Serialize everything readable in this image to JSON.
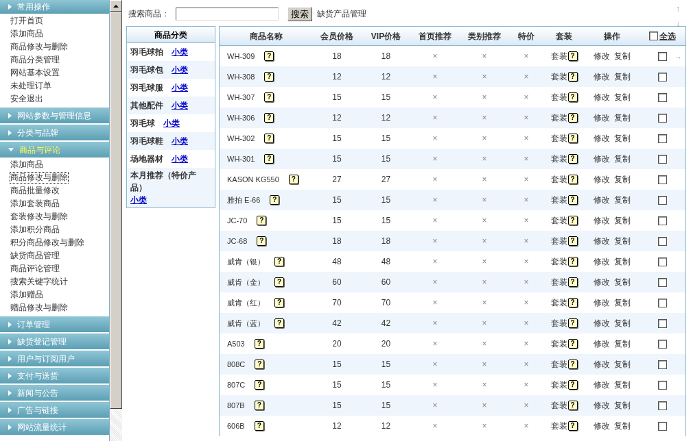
{
  "sidebar": {
    "sections": [
      {
        "title": "常用操作",
        "kind": "fixed",
        "items": [
          {
            "label": "打开首页",
            "selected": false
          },
          {
            "label": "添加商品",
            "selected": false
          },
          {
            "label": "商品修改与删除",
            "selected": false
          },
          {
            "label": "商品分类管理",
            "selected": false
          },
          {
            "label": "网站基本设置",
            "selected": false
          },
          {
            "label": "未处理订单",
            "selected": false
          },
          {
            "label": "安全退出",
            "selected": false
          }
        ]
      },
      {
        "title": "网站参数与管理信息",
        "expanded": false
      },
      {
        "title": "分类与品牌",
        "expanded": false
      },
      {
        "title": "商品与评论",
        "expanded": true,
        "items": [
          {
            "label": "添加商品",
            "selected": false
          },
          {
            "label": "商品修改与删除",
            "selected": true
          },
          {
            "label": "商品批量修改",
            "selected": false
          },
          {
            "label": "添加套装商品",
            "selected": false
          },
          {
            "label": "套装修改与删除",
            "selected": false
          },
          {
            "label": "添加积分商品",
            "selected": false
          },
          {
            "label": "积分商品修改与删除",
            "selected": false
          },
          {
            "label": "缺货商品管理",
            "selected": false
          },
          {
            "label": "商品评论管理",
            "selected": false
          },
          {
            "label": "搜索关键字统计",
            "selected": false
          },
          {
            "label": "添加赠品",
            "selected": false
          },
          {
            "label": "赠品修改与删除",
            "selected": false
          }
        ]
      },
      {
        "title": "订单管理",
        "expanded": false
      },
      {
        "title": "缺货登记管理",
        "expanded": false
      },
      {
        "title": "用户与订阅用户",
        "expanded": false
      },
      {
        "title": "支付与送货",
        "expanded": false
      },
      {
        "title": "新闻与公告",
        "expanded": false
      },
      {
        "title": "广告与链接",
        "expanded": false
      },
      {
        "title": "网站流量统计",
        "expanded": false
      }
    ]
  },
  "search": {
    "label": "搜索商品：",
    "button": "搜索",
    "link": "缺货产品管理"
  },
  "corner_arrows": [
    "↑",
    "↓",
    "→"
  ],
  "categories": {
    "title": "商品分类",
    "items": [
      {
        "name": "羽毛球拍",
        "link": "小类"
      },
      {
        "name": "羽毛球包",
        "link": "小类"
      },
      {
        "name": "羽毛球服",
        "link": "小类"
      },
      {
        "name": "其他配件",
        "link": "小类"
      },
      {
        "name": "羽毛球",
        "link": "小类"
      },
      {
        "name": "羽毛球鞋",
        "link": "小类"
      },
      {
        "name": "场地器材",
        "link": "小类"
      },
      {
        "name": "本月推荐（特价产品）",
        "link": "小类"
      }
    ]
  },
  "table": {
    "columns": [
      "商品名称",
      "会员价格",
      "VIP价格",
      "首页推荐",
      "类别推荐",
      "特价",
      "套装",
      "操作"
    ],
    "select_all": {
      "label": "全选",
      "checked": false
    },
    "help_glyph": "?",
    "rows": [
      {
        "name": "WH-309",
        "member_price": "18",
        "vip_price": "18",
        "home_rec": "×",
        "cat_rec": "×",
        "special": "×",
        "set": "套装",
        "actions": [
          "修改",
          "复制"
        ],
        "checked": false
      },
      {
        "name": "WH-308",
        "member_price": "12",
        "vip_price": "12",
        "home_rec": "×",
        "cat_rec": "×",
        "special": "×",
        "set": "套装",
        "actions": [
          "修改",
          "复制"
        ],
        "checked": false
      },
      {
        "name": "WH-307",
        "member_price": "15",
        "vip_price": "15",
        "home_rec": "×",
        "cat_rec": "×",
        "special": "×",
        "set": "套装",
        "actions": [
          "修改",
          "复制"
        ],
        "checked": false
      },
      {
        "name": "WH-306",
        "member_price": "12",
        "vip_price": "12",
        "home_rec": "×",
        "cat_rec": "×",
        "special": "×",
        "set": "套装",
        "actions": [
          "修改",
          "复制"
        ],
        "checked": false
      },
      {
        "name": "WH-302",
        "member_price": "15",
        "vip_price": "15",
        "home_rec": "×",
        "cat_rec": "×",
        "special": "×",
        "set": "套装",
        "actions": [
          "修改",
          "复制"
        ],
        "checked": false
      },
      {
        "name": "WH-301",
        "member_price": "15",
        "vip_price": "15",
        "home_rec": "×",
        "cat_rec": "×",
        "special": "×",
        "set": "套装",
        "actions": [
          "修改",
          "复制"
        ],
        "checked": false
      },
      {
        "name": "KASON KG550",
        "member_price": "27",
        "vip_price": "27",
        "home_rec": "×",
        "cat_rec": "×",
        "special": "×",
        "set": "套装",
        "actions": [
          "修改",
          "复制"
        ],
        "checked": false
      },
      {
        "name": "雅拍 E-66",
        "member_price": "15",
        "vip_price": "15",
        "home_rec": "×",
        "cat_rec": "×",
        "special": "×",
        "set": "套装",
        "actions": [
          "修改",
          "复制"
        ],
        "checked": false
      },
      {
        "name": "JC-70",
        "member_price": "15",
        "vip_price": "15",
        "home_rec": "×",
        "cat_rec": "×",
        "special": "×",
        "set": "套装",
        "actions": [
          "修改",
          "复制"
        ],
        "checked": false
      },
      {
        "name": "JC-68",
        "member_price": "18",
        "vip_price": "18",
        "home_rec": "×",
        "cat_rec": "×",
        "special": "×",
        "set": "套装",
        "actions": [
          "修改",
          "复制"
        ],
        "checked": false
      },
      {
        "name": "威肯（银）",
        "member_price": "48",
        "vip_price": "48",
        "home_rec": "×",
        "cat_rec": "×",
        "special": "×",
        "set": "套装",
        "actions": [
          "修改",
          "复制"
        ],
        "checked": false
      },
      {
        "name": "威肯（金）",
        "member_price": "60",
        "vip_price": "60",
        "home_rec": "×",
        "cat_rec": "×",
        "special": "×",
        "set": "套装",
        "actions": [
          "修改",
          "复制"
        ],
        "checked": false
      },
      {
        "name": "威肯（红）",
        "member_price": "70",
        "vip_price": "70",
        "home_rec": "×",
        "cat_rec": "×",
        "special": "×",
        "set": "套装",
        "actions": [
          "修改",
          "复制"
        ],
        "checked": false
      },
      {
        "name": "威肯（蓝）",
        "member_price": "42",
        "vip_price": "42",
        "home_rec": "×",
        "cat_rec": "×",
        "special": "×",
        "set": "套装",
        "actions": [
          "修改",
          "复制"
        ],
        "checked": false
      },
      {
        "name": "A503",
        "member_price": "20",
        "vip_price": "20",
        "home_rec": "×",
        "cat_rec": "×",
        "special": "×",
        "set": "套装",
        "actions": [
          "修改",
          "复制"
        ],
        "checked": false
      },
      {
        "name": "808C",
        "member_price": "15",
        "vip_price": "15",
        "home_rec": "×",
        "cat_rec": "×",
        "special": "×",
        "set": "套装",
        "actions": [
          "修改",
          "复制"
        ],
        "checked": false
      },
      {
        "name": "807C",
        "member_price": "15",
        "vip_price": "15",
        "home_rec": "×",
        "cat_rec": "×",
        "special": "×",
        "set": "套装",
        "actions": [
          "修改",
          "复制"
        ],
        "checked": false
      },
      {
        "name": "807B",
        "member_price": "15",
        "vip_price": "15",
        "home_rec": "×",
        "cat_rec": "×",
        "special": "×",
        "set": "套装",
        "actions": [
          "修改",
          "复制"
        ],
        "checked": false
      },
      {
        "name": "606B",
        "member_price": "12",
        "vip_price": "12",
        "home_rec": "×",
        "cat_rec": "×",
        "special": "×",
        "set": "套装",
        "actions": [
          "修改",
          "复制"
        ],
        "checked": false
      }
    ]
  }
}
